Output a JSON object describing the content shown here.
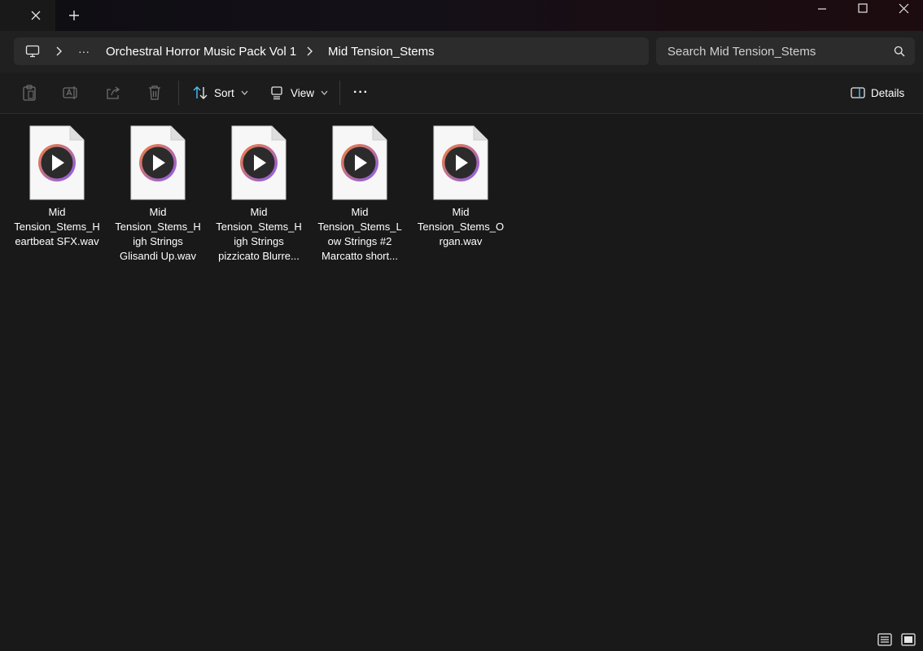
{
  "window": {
    "tab_close_glyph": "✕",
    "new_tab_glyph": "+",
    "minimize_glyph": "—",
    "maximize_glyph": "☐",
    "close_glyph": "✕"
  },
  "breadcrumb": {
    "overflow_label": "···",
    "items": [
      "Orchestral Horror Music Pack Vol 1",
      "Mid Tension_Stems"
    ]
  },
  "search": {
    "placeholder": "Search Mid Tension_Stems"
  },
  "toolbar": {
    "sort_label": "Sort",
    "view_label": "View",
    "more_label": "···",
    "details_label": "Details"
  },
  "files": [
    {
      "lines": [
        "Mid",
        "Tension_Stems_H",
        "eartbeat SFX.wav"
      ]
    },
    {
      "lines": [
        "Mid",
        "Tension_Stems_H",
        "igh Strings",
        "Glisandi Up.wav"
      ]
    },
    {
      "lines": [
        "Mid",
        "Tension_Stems_H",
        "igh Strings",
        "pizzicato Blurre..."
      ]
    },
    {
      "lines": [
        "Mid",
        "Tension_Stems_L",
        "ow Strings #2",
        "Marcatto short..."
      ]
    },
    {
      "lines": [
        "Mid",
        "Tension_Stems_O",
        "rgan.wav"
      ]
    }
  ],
  "colors": {
    "background": "#191919",
    "media_ring_orange": "#f0803c",
    "media_ring_purple": "#8a5cf0",
    "accent_blue": "#4cc2ff"
  }
}
